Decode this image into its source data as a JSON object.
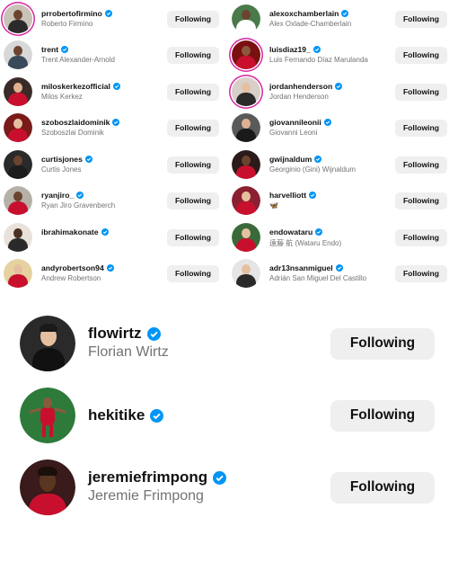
{
  "following_label": "Following",
  "left_column": [
    {
      "username": "prrobertofirmino",
      "full_name": "Roberto Firmino",
      "verified": true,
      "story_ring": true,
      "avatar_bg": "#c9c2b6",
      "jersey": "#2b2b2b",
      "skin": "#6b4430"
    },
    {
      "username": "trent",
      "full_name": "Trent Alexander-Arnold",
      "verified": true,
      "story_ring": false,
      "avatar_bg": "#d8d8d8",
      "jersey": "#3a4a5a",
      "skin": "#6b4430"
    },
    {
      "username": "miloskerkezofficial",
      "full_name": "Milos Kerkez",
      "verified": true,
      "story_ring": false,
      "avatar_bg": "#3a2a28",
      "jersey": "#c8102e",
      "skin": "#e0b090"
    },
    {
      "username": "szoboszlaidominik",
      "full_name": "Szoboszlai Dominik",
      "verified": true,
      "story_ring": false,
      "avatar_bg": "#7a1a1a",
      "jersey": "#c8102e",
      "skin": "#e5c0a0"
    },
    {
      "username": "curtisjones",
      "full_name": "Curtis Jones",
      "verified": true,
      "story_ring": false,
      "avatar_bg": "#2a2a2a",
      "jersey": "#1d1d1d",
      "skin": "#6b4430"
    },
    {
      "username": "ryanjiro_",
      "full_name": "Ryan Jiro Gravenberch",
      "verified": true,
      "story_ring": false,
      "avatar_bg": "#b5b0a8",
      "jersey": "#c8102e",
      "skin": "#6b4430"
    },
    {
      "username": "ibrahimakonate",
      "full_name": "",
      "verified": true,
      "story_ring": false,
      "avatar_bg": "#e8e2da",
      "jersey": "#2a2a2a",
      "skin": "#4a3020"
    },
    {
      "username": "andyrobertson94",
      "full_name": "Andrew Robertson",
      "verified": true,
      "story_ring": false,
      "avatar_bg": "#e5d2a0",
      "jersey": "#c8102e",
      "skin": "#e5c0a0"
    }
  ],
  "right_column": [
    {
      "username": "alexoxchamberlain",
      "full_name": "Alex Oxlade-Chamberlain",
      "verified": true,
      "story_ring": false,
      "avatar_bg": "#4a7a4a",
      "jersey": "#ffffff",
      "skin": "#6b4430"
    },
    {
      "username": "luisdiaz19_",
      "full_name": "Luis Fernando Díaz Marulanda",
      "verified": true,
      "story_ring": true,
      "avatar_bg": "#7a1010",
      "jersey": "#c8102e",
      "skin": "#8a5a3c"
    },
    {
      "username": "jordanhenderson",
      "full_name": "Jordan Henderson",
      "verified": true,
      "story_ring": true,
      "avatar_bg": "#d8d0c8",
      "jersey": "#2a2a2a",
      "skin": "#e5c0a0"
    },
    {
      "username": "giovannileonii",
      "full_name": "Giovanni Leoni",
      "verified": true,
      "story_ring": false,
      "avatar_bg": "#5a5a5a",
      "jersey": "#1a1a1a",
      "skin": "#e0b090"
    },
    {
      "username": "gwijnaldum",
      "full_name": "Georginio (Gini) Wijnaldum",
      "verified": true,
      "story_ring": false,
      "avatar_bg": "#2a1a1a",
      "jersey": "#c8102e",
      "skin": "#6b4430"
    },
    {
      "username": "harvelliott",
      "full_name": "🦋",
      "verified": true,
      "story_ring": false,
      "avatar_bg": "#8a2030",
      "jersey": "#c8102e",
      "skin": "#e5c0a0"
    },
    {
      "username": "endowataru",
      "full_name": "遠藤 航 (Wataru Endo)",
      "verified": true,
      "story_ring": false,
      "avatar_bg": "#3a6a3a",
      "jersey": "#c8102e",
      "skin": "#e5c0a0"
    },
    {
      "username": "adr13nsanmiguel",
      "full_name": "Adrián San Miguel Del Castillo",
      "verified": true,
      "story_ring": false,
      "avatar_bg": "#e5e5e5",
      "jersey": "#2a2a2a",
      "skin": "#e5c0a0"
    }
  ],
  "large_list": [
    {
      "username": "flowirtz",
      "full_name": "Florian Wirtz",
      "verified": true,
      "avatar_bg": "#2a2a2a",
      "jersey": "#111111",
      "skin": "#e5c0a0"
    },
    {
      "username": "hekitike",
      "full_name": "",
      "verified": true,
      "avatar_bg": "#2e7a3a",
      "jersey": "#c8102e",
      "skin": "#8a5a3c"
    },
    {
      "username": "jeremiefrimpong",
      "full_name": "Jeremie Frimpong",
      "verified": true,
      "avatar_bg": "#3a1a1a",
      "jersey": "#c8102e",
      "skin": "#5a3520"
    }
  ],
  "colors": {
    "verified_badge": "#0095f6",
    "button_bg": "#efefef",
    "secondary_text": "#737373",
    "story_ring": "#d6249f"
  }
}
